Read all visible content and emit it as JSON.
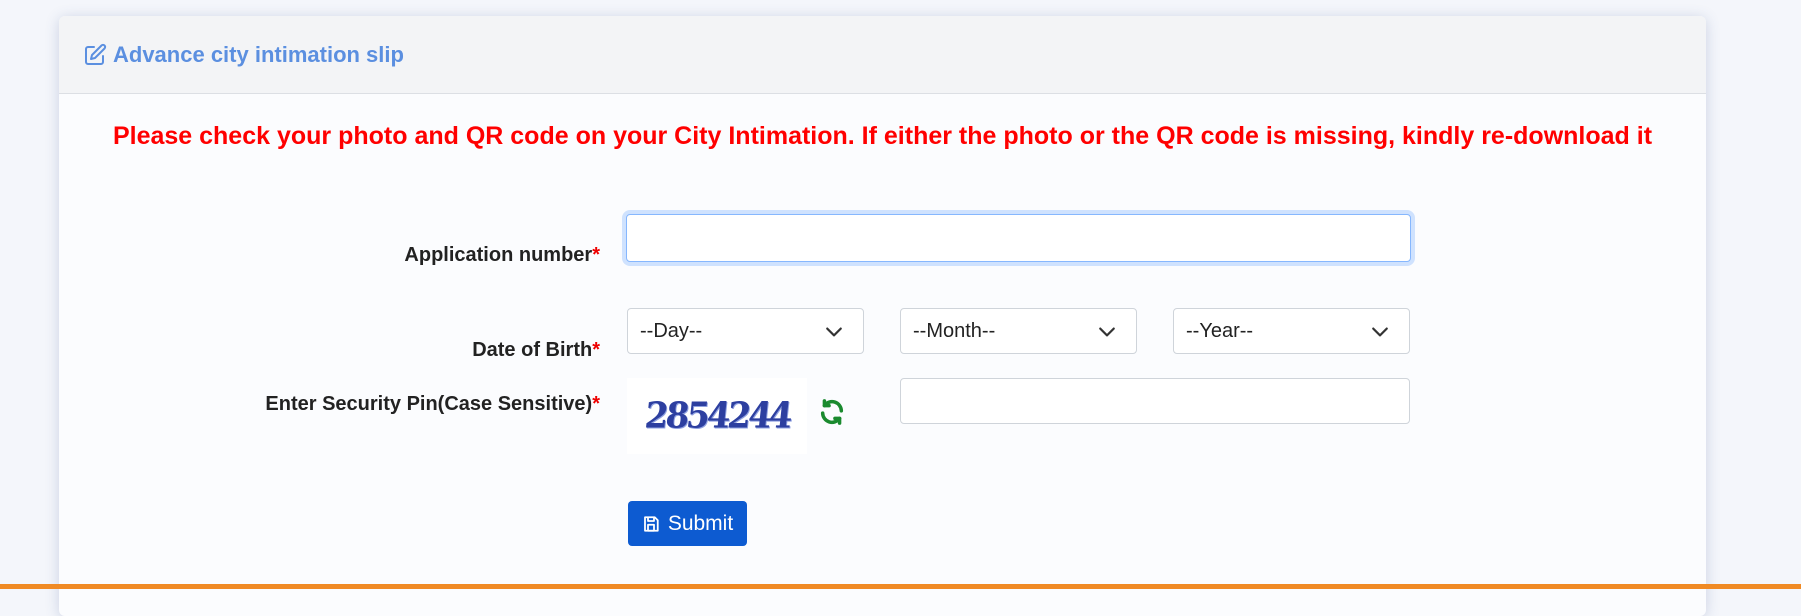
{
  "header": {
    "title": "Advance city intimation slip",
    "icon": "edit-icon"
  },
  "notice": "Please check your photo and QR code on your City Intimation. If either the photo or the QR code is missing, kindly re-download it",
  "form": {
    "application_number": {
      "label": "Application number",
      "required_mark": "*",
      "value": "",
      "placeholder": ""
    },
    "date_of_birth": {
      "label": "Date of Birth",
      "required_mark": "*",
      "day": "--Day--",
      "month": "--Month--",
      "year": "--Year--"
    },
    "security_pin": {
      "label": "Enter Security Pin(Case Sensitive)",
      "required_mark": "*",
      "captcha_text": "2854244",
      "value": ""
    },
    "submit_label": "Submit"
  },
  "colors": {
    "title": "#5b8fe0",
    "notice": "#ff0000",
    "required": "#ee0000",
    "submit_bg": "#0d5bd1",
    "refresh_icon": "#1a8a2e",
    "bottom_bar": "#f08a24"
  }
}
